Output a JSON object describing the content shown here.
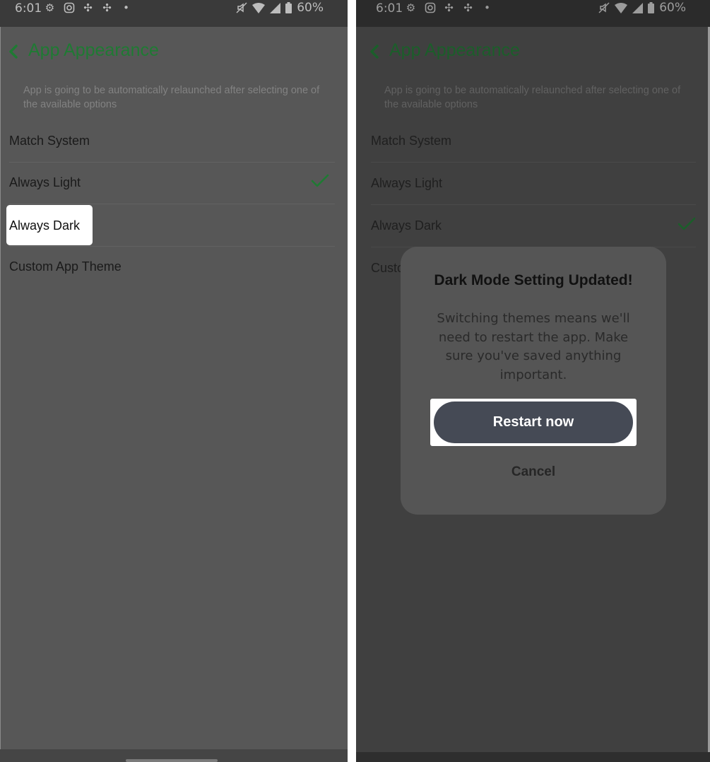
{
  "colors": {
    "accent_green": "#1f7a33",
    "dialog_button": "#454a55",
    "highlight": "#ffffff"
  },
  "left_screen": {
    "status_bar": {
      "time": "6:01",
      "battery": "60%",
      "icons": [
        "settings-icon",
        "instagram-icon",
        "pinwheel-icon",
        "pinwheel-icon",
        "dot-icon",
        "mute-icon",
        "wifi-icon",
        "signal-icon",
        "battery-icon"
      ]
    },
    "header": {
      "title": "App Appearance"
    },
    "notice": "App is going to be automatically relaunched after selecting one of the available options",
    "options": [
      {
        "label": "Match System",
        "selected": false
      },
      {
        "label": "Always Light",
        "selected": true
      },
      {
        "label": "Always Dark",
        "selected": false,
        "highlighted": true
      },
      {
        "label": "Custom App Theme",
        "selected": false
      }
    ]
  },
  "right_screen": {
    "status_bar": {
      "time": "6:01",
      "battery": "60%"
    },
    "header": {
      "title": "App Appearance"
    },
    "notice": "App is going to be automatically relaunched after selecting one of the available options",
    "options": [
      {
        "label": "Match System",
        "selected": false
      },
      {
        "label": "Always Light",
        "selected": false
      },
      {
        "label": "Always Dark",
        "selected": true
      },
      {
        "label": "Custo",
        "selected": false
      }
    ],
    "dialog": {
      "title": "Dark Mode Setting Updated!",
      "body": "Switching themes means we'll need to restart the app. Make sure you've saved anything important.",
      "primary_button": "Restart now",
      "secondary_button": "Cancel"
    }
  }
}
